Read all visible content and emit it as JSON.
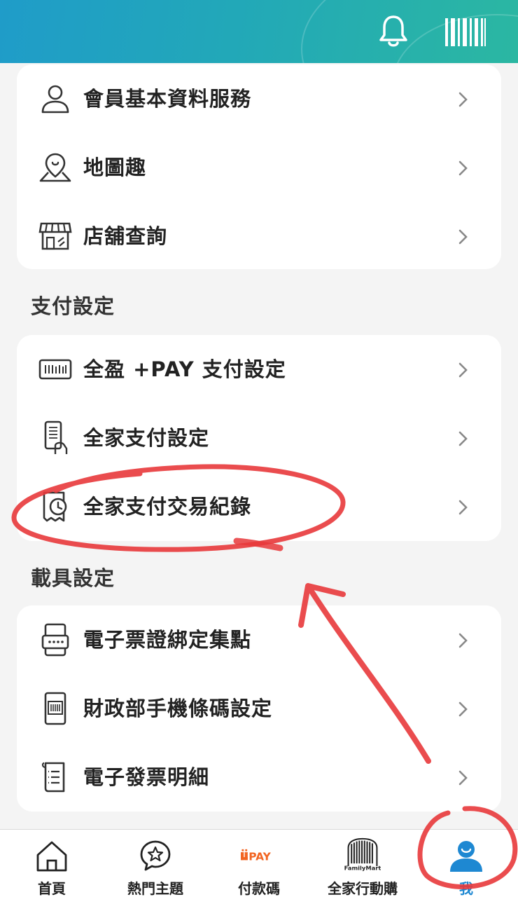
{
  "header": {
    "bell_icon": "bell-icon",
    "barcode_icon": "barcode-icon"
  },
  "sections": {
    "member": {
      "items": [
        {
          "label": "會員基本資料服務",
          "icon": "user-icon"
        },
        {
          "label": "地圖趣",
          "icon": "map-pin-icon"
        },
        {
          "label": "店舖查詢",
          "icon": "store-icon"
        }
      ]
    },
    "payment": {
      "title": "支付設定",
      "items": [
        {
          "label": "全盈 +PAY 支付設定",
          "icon": "card-reader-icon"
        },
        {
          "label": "全家支付設定",
          "icon": "phone-pay-icon"
        },
        {
          "label": "全家支付交易紀錄",
          "icon": "receipt-history-icon"
        }
      ]
    },
    "carrier": {
      "title": "載具設定",
      "items": [
        {
          "label": "電子票證綁定集點",
          "icon": "ticket-card-icon"
        },
        {
          "label": "財政部手機條碼設定",
          "icon": "mobile-barcode-icon"
        },
        {
          "label": "電子發票明細",
          "icon": "invoice-icon"
        }
      ]
    }
  },
  "tabbar": {
    "tabs": [
      {
        "label": "首頁",
        "icon": "home-icon"
      },
      {
        "label": "熱門主題",
        "icon": "star-chat-icon"
      },
      {
        "label": "付款碼",
        "icon": "pay-logo",
        "logo_text": "PAY"
      },
      {
        "label": "全家行動購",
        "icon": "familymart-logo",
        "logo_text": "FamilyMart"
      },
      {
        "label": "我",
        "icon": "profile-icon",
        "active": true
      }
    ]
  },
  "colors": {
    "header_gradient": [
      "#1f9cc9",
      "#2bb7a2"
    ],
    "active_tab": "#1e88d2",
    "annotation_red": "#e8383b",
    "pay_orange": "#f26522"
  }
}
